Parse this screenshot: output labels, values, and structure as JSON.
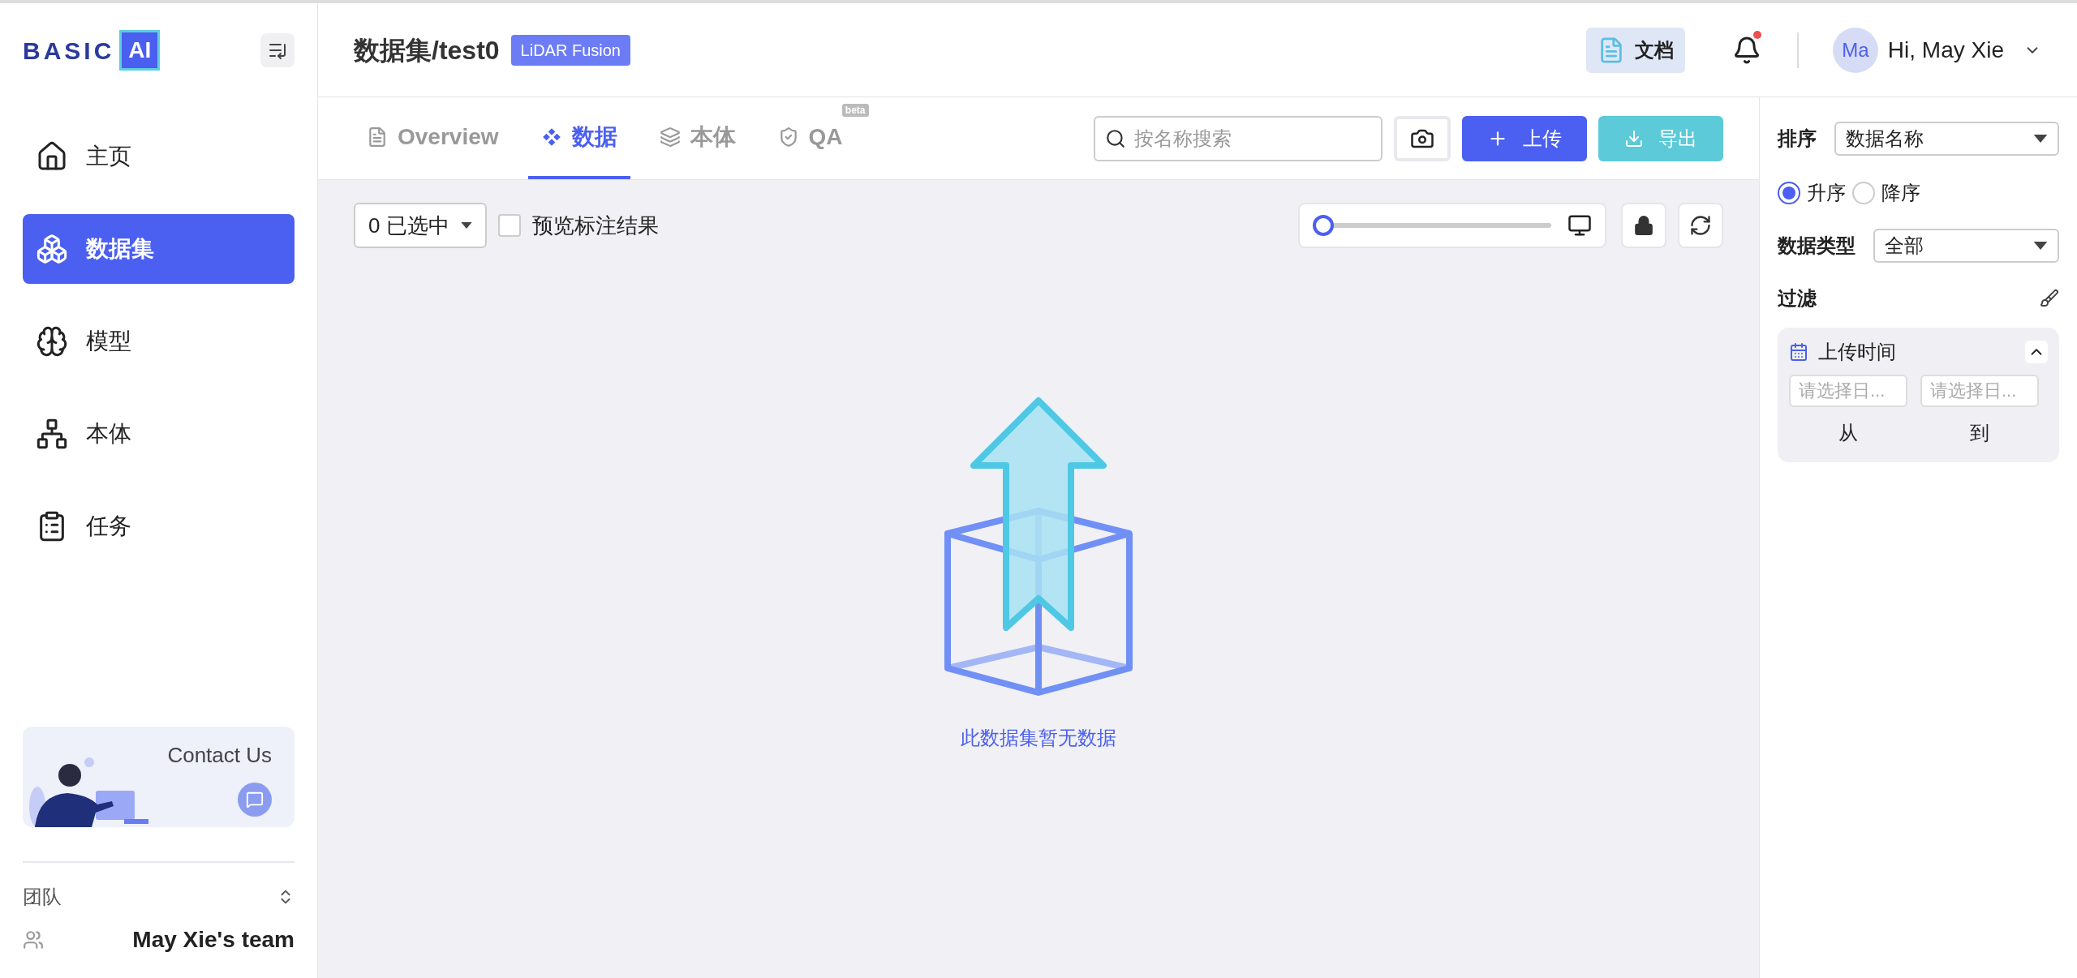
{
  "logo": {
    "word": "BASIC",
    "mark": "AI"
  },
  "nav": [
    {
      "label": "主页",
      "selected": false
    },
    {
      "label": "数据集",
      "selected": true
    },
    {
      "label": "模型",
      "selected": false
    },
    {
      "label": "本体",
      "selected": false
    },
    {
      "label": "任务",
      "selected": false
    }
  ],
  "contact_card": {
    "title": "Contact Us"
  },
  "team": {
    "label": "团队",
    "name": "May Xie's team"
  },
  "header": {
    "title": "数据集/test0",
    "badge": "LiDAR Fusion",
    "docs_button": "文档",
    "notification_dot": true,
    "avatar": "Ma",
    "greeting": "Hi, May Xie"
  },
  "tabs": [
    {
      "label": "Overview",
      "selected": false
    },
    {
      "label": "数据",
      "selected": true
    },
    {
      "label": "本体",
      "selected": false
    },
    {
      "label": "QA",
      "selected": false,
      "badge": "beta"
    }
  ],
  "search": {
    "placeholder": "按名称搜索"
  },
  "buttons": {
    "upload": "上传",
    "export": "导出"
  },
  "toolbar": {
    "selection": "0 已选中",
    "preview_label": "预览标注结果",
    "preview_checked": false,
    "zoom_slider": {
      "level": 0
    }
  },
  "empty_state": {
    "message": "此数据集暂无数据"
  },
  "side_panel": {
    "sort_label": "排序",
    "sort_value": "数据名称",
    "order": [
      {
        "label": "升序",
        "selected": true
      },
      {
        "label": "降序",
        "selected": false
      }
    ],
    "type_label": "数据类型",
    "type_value": "全部",
    "filter_label": "过滤",
    "filter_card": {
      "title": "上传时间",
      "expanded": true,
      "from_placeholder": "请选择日...",
      "to_placeholder": "请选择日...",
      "from_label": "从",
      "to_label": "到"
    }
  }
}
